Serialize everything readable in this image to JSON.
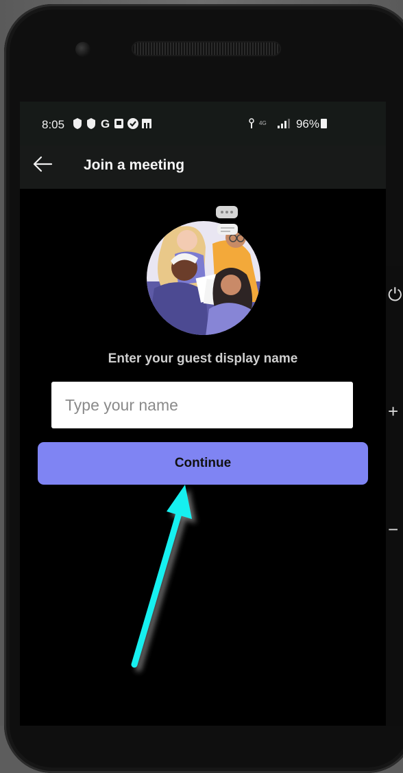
{
  "status_bar": {
    "time": "8:05",
    "left_icons": "⬤ ⬤ G ▣ ✔ ▤",
    "signal": "☷ ᴴᴳ .░",
    "battery": "96%"
  },
  "app_bar": {
    "title": "Join a meeting"
  },
  "main": {
    "prompt": "Enter your guest display name",
    "name_input": {
      "value": "",
      "placeholder": "Type your name"
    },
    "continue_label": "Continue"
  },
  "colors": {
    "accent": "#7f84f3",
    "annotation_arrow": "#17f0f0"
  },
  "icons": {
    "back": "arrow-left-icon",
    "power": "power-icon",
    "volume_up": "plus-icon",
    "volume_down": "minus-icon"
  }
}
